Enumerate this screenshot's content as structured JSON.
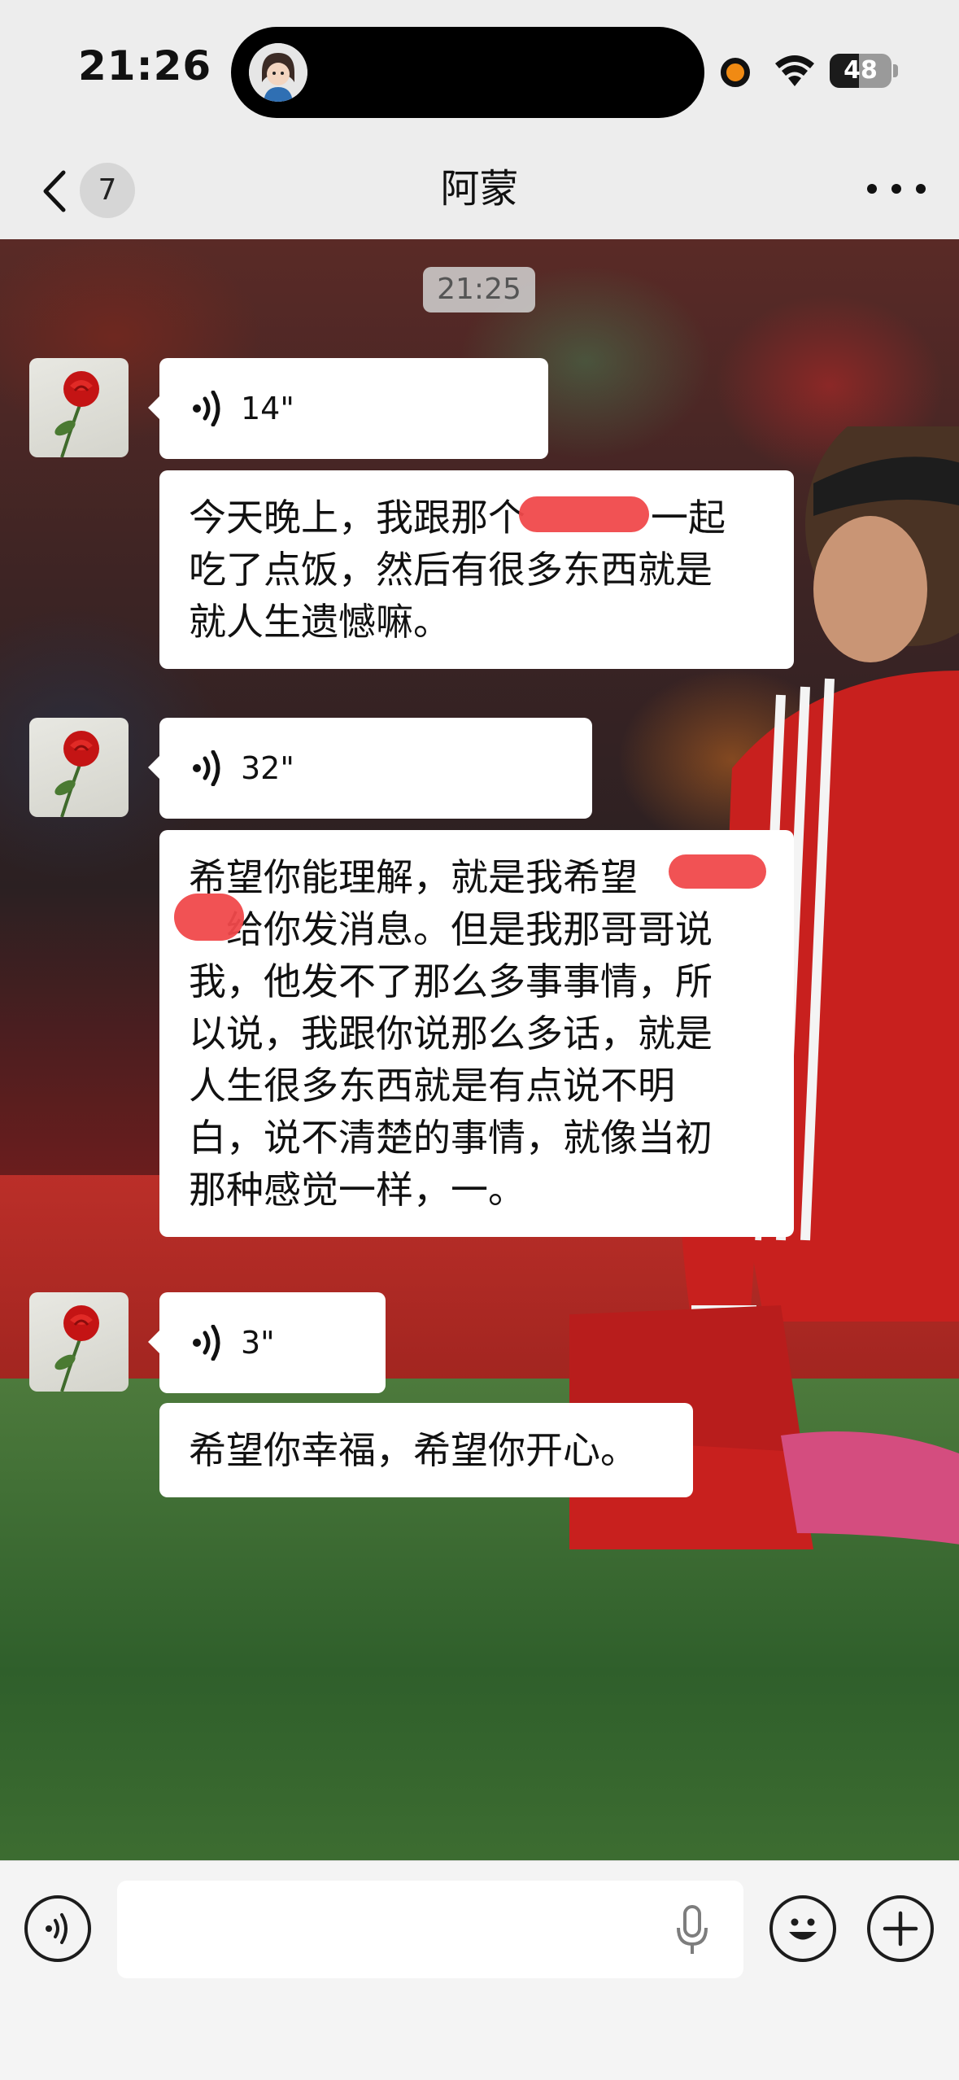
{
  "status_bar": {
    "time": "21:26",
    "battery_level": "48",
    "battery_fraction": 0.48,
    "indicator_color": "#f08a13"
  },
  "nav": {
    "back_icon": "chevron-left-icon",
    "unread_count": "7",
    "title": "阿蒙",
    "more_icon": "ellipsis-icon"
  },
  "chat": {
    "timestamp": "21:25",
    "avatar_icon": "red-rose-avatar",
    "messages": [
      {
        "type": "voice",
        "duration": "14\""
      },
      {
        "type": "text",
        "lines": [
          "今天晚上，我跟那个",
          "吃了点饭，然后有很多东西就是",
          "就人生遗憾嘛。"
        ],
        "line1_tail": "一起"
      },
      {
        "type": "voice",
        "duration": "32\""
      },
      {
        "type": "text",
        "lines": [
          "希望你能理解，就是我希望",
          "给你发消息。但是我那哥哥说",
          "我，他发不了那么多事事情，所",
          "以说，我跟你说那么多话，就是",
          "人生很多东西就是有点说不明",
          "白，说不清楚的事情，就像当初",
          "那种感觉一样，一。"
        ]
      },
      {
        "type": "voice",
        "duration": "3\""
      },
      {
        "type": "text",
        "lines": [
          "希望你幸福，希望你开心。"
        ]
      }
    ],
    "redaction_color": "#f0494b"
  },
  "input_bar": {
    "voice_toggle_icon": "voice-wave-icon",
    "placeholder": "",
    "mic_icon": "microphone-icon",
    "emoji_icon": "smiley-icon",
    "plus_icon": "plus-icon"
  }
}
